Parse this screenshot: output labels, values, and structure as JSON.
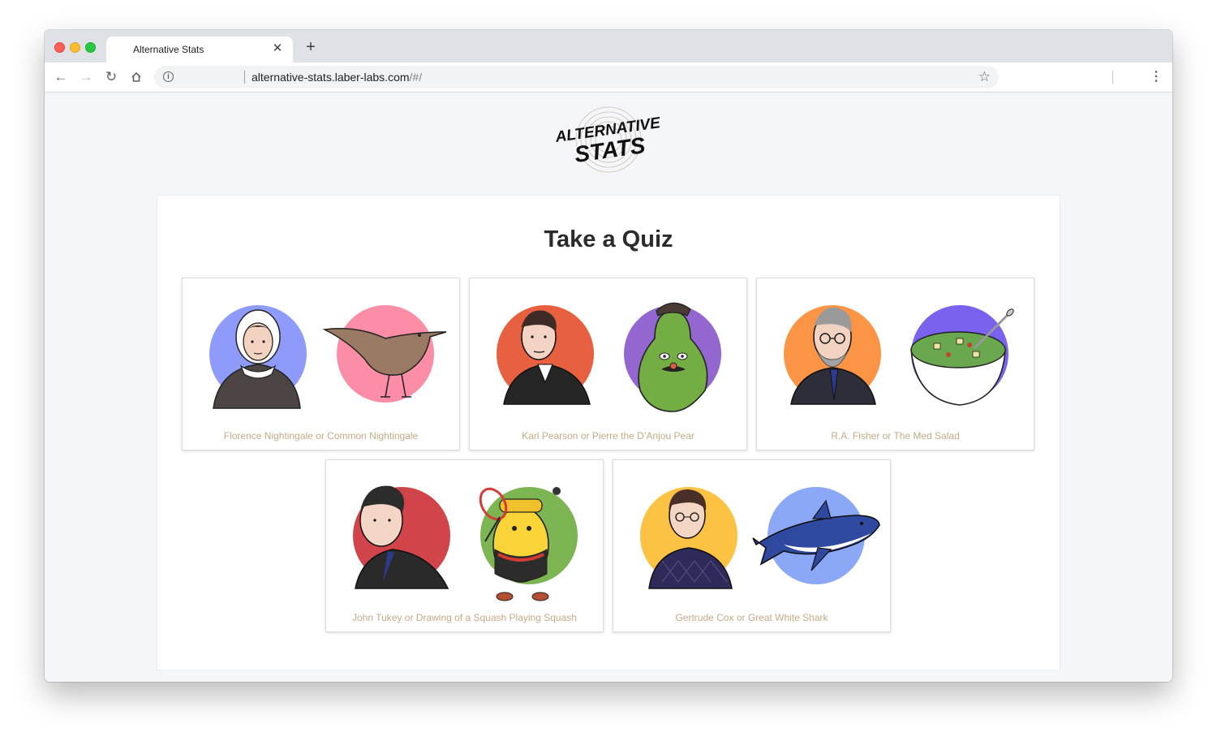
{
  "browser": {
    "tab_title": "Alternative Stats",
    "tab_close_icon": "close-icon",
    "new_tab_icon": "plus-icon",
    "url_host": "alternative-stats.laber-labs.com",
    "url_path": "/#/",
    "back_icon": "back-arrow-icon",
    "forward_icon": "forward-arrow-icon",
    "reload_icon": "reload-icon",
    "home_icon": "home-icon",
    "info_icon": "info-icon",
    "bookmark_icon": "star-icon",
    "menu_icon": "kebab-menu-icon"
  },
  "logo": {
    "line1": "ALTERNATIVE",
    "line2": "STATS"
  },
  "main": {
    "heading": "Take a Quiz",
    "quizzes": [
      {
        "label": "Florence Nightingale or Common Nightingale",
        "left_color": "#8f9bfb",
        "right_color": "#fb8ea6"
      },
      {
        "label": "Karl Pearson or Pierre the D’Anjou Pear",
        "left_color": "#e7603f",
        "right_color": "#9466cf"
      },
      {
        "label": "R.A. Fisher or The Med Salad",
        "left_color": "#fb9444",
        "right_color": "#7a61ee"
      },
      {
        "label": "John Tukey or Drawing of a Squash Playing Squash",
        "left_color": "#d1444a",
        "right_color": "#7cb552"
      },
      {
        "label": "Gertrude Cox or Great White Shark",
        "left_color": "#fcc243",
        "right_color": "#8aa8f5"
      }
    ]
  }
}
